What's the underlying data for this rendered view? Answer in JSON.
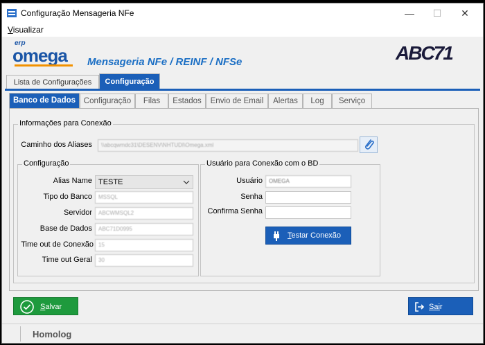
{
  "window": {
    "title": "Configuração Mensageria NFe",
    "minimize": "—",
    "maximize": "☐",
    "close": "✕"
  },
  "menu": {
    "visualizar_first": "V",
    "visualizar_rest": "isualizar"
  },
  "header": {
    "logo_erp": "erp",
    "logo_omega": "omega",
    "subtitle": "Mensageria NFe / REINF / NFSe",
    "brand": "ABC71"
  },
  "top_tabs": {
    "lista": "Lista de Configurações",
    "config": "Configuração",
    "active": "Configuração"
  },
  "sub_tabs": [
    "Banco de Dados",
    "Configuração",
    "Filas",
    "Estados",
    "Envio de Email",
    "Alertas",
    "Log",
    "Serviço"
  ],
  "sub_tabs_active": "Banco de Dados",
  "conexao": {
    "title": "Informações para Conexão",
    "caminho_label": "Caminho dos Aliases",
    "caminho_value": "\\\\abcqwmdc31\\DESENV\\NHTUDI\\Omega.xml"
  },
  "configuracao": {
    "title": "Configuração",
    "alias_label": "Alias Name",
    "alias_value": "TESTE",
    "tipo_label": "Tipo do Banco",
    "tipo_value": "MSSQL",
    "servidor_label": "Servidor",
    "servidor_value": "ABCWMSQL2",
    "base_label": "Base de Dados",
    "base_value": "ABC71D0995",
    "timeout_conexao_label": "Time out de Conexão",
    "timeout_conexao_value": "15",
    "timeout_geral_label": "Time out Geral",
    "timeout_geral_value": "30"
  },
  "usuario": {
    "title": "Usuário para Conexão com o BD",
    "usuario_label": "Usuário",
    "usuario_value": "OMEGA",
    "senha_label": "Senha",
    "senha_value": "",
    "confirma_label": "Confirma Senha",
    "confirma_value": "",
    "test_first": "T",
    "test_rest": "estar Conexão"
  },
  "buttons": {
    "salvar_first": "S",
    "salvar_rest": "alvar",
    "sair_first": "Sai",
    "sair_rest": "r"
  },
  "status": {
    "text": "Homolog"
  },
  "colors": {
    "accent": "#1b5fb8",
    "save": "#1e9a3d",
    "logo": "#1a55a6",
    "logo_underline": "#f29100"
  }
}
